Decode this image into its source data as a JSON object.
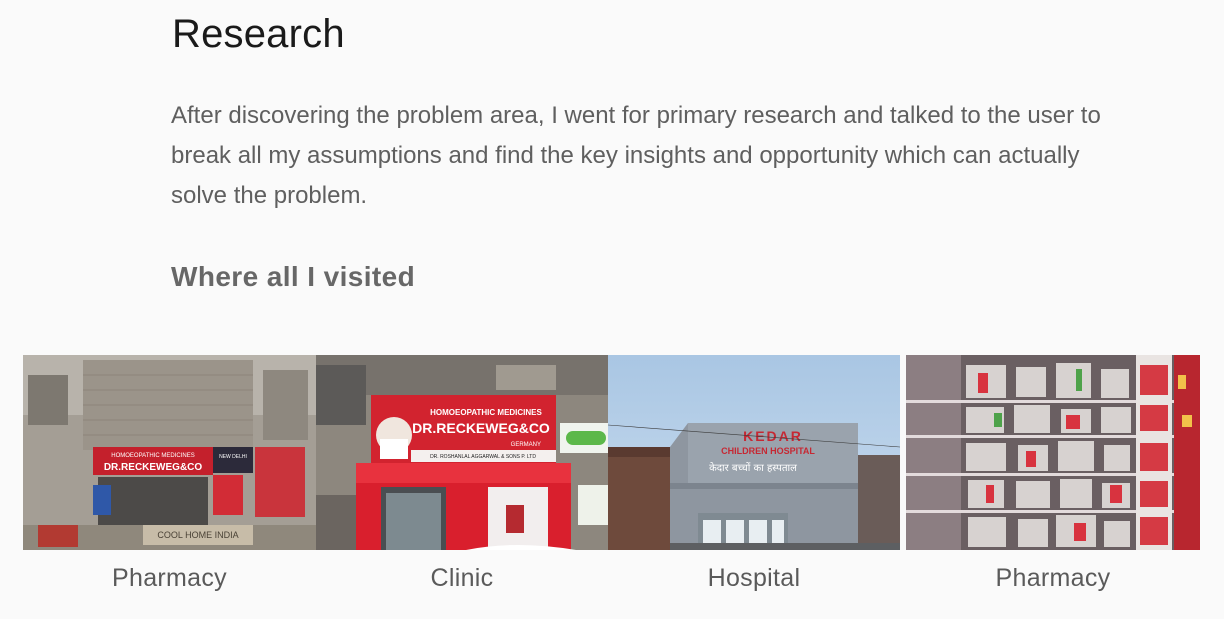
{
  "research": {
    "title": "Research",
    "paragraph": "After discovering the problem area, I went for primary research and talked to the user to break all my assumptions and find the key insights and opportunity which can actually solve the problem.",
    "subheading": "Where all I visited"
  },
  "places": [
    {
      "caption": "Pharmacy",
      "sign_line1": "HOMOEOPATHIC MEDICINES",
      "sign_line2": "DR.RECKEWEG&CO",
      "side_sign": "NEW DELHI",
      "shop_sign": "COOL HOME INDIA",
      "icon": "pharmacy-storefront-photo"
    },
    {
      "caption": "Clinic",
      "sign_line1": "HOMOEOPATHIC MEDICINES",
      "sign_line2": "DR.RECKEWEG&CO",
      "sign_line3": "GERMANY",
      "sign_line4": "DR. ROSHANLAL AGGARWAL & SONS P. LTD",
      "icon": "clinic-storefront-photo"
    },
    {
      "caption": "Hospital",
      "sign_line1": "KEDAR",
      "sign_line2": "CHILDREN HOSPITAL",
      "sign_line3": "केदार बच्चों का हस्पताल",
      "icon": "hospital-building-photo"
    },
    {
      "caption": "Pharmacy",
      "icon": "pharmacy-shelves-photo"
    }
  ]
}
